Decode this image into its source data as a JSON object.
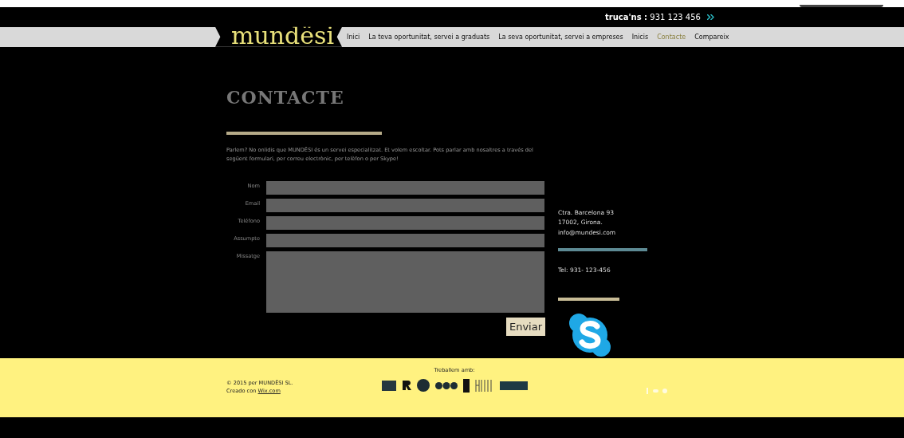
{
  "header": {
    "call_label": "truca'ns :",
    "phone": "931 123 456",
    "logo": "mundësi"
  },
  "nav": [
    {
      "label": "Inici",
      "selected": false
    },
    {
      "label": "La teva oportunitat, servei a graduats",
      "selected": false
    },
    {
      "label": "La seva oportunitat, servei a empreses",
      "selected": false
    },
    {
      "label": "Inicis",
      "selected": false
    },
    {
      "label": "Contacte",
      "selected": true
    },
    {
      "label": "Compareix",
      "selected": false
    }
  ],
  "page": {
    "title": "CONTACTE",
    "intro": "Parlem? No onlidis que MUNDËSI és un servei especialitzat. Et volem escoltar. Pots parlar amb nosaltres a través del següent formulari, per correu electrònic, per telèfon o per Skype!"
  },
  "form": {
    "fields": [
      {
        "label": "Nom",
        "kind": "line"
      },
      {
        "label": "Email",
        "kind": "line"
      },
      {
        "label": "Teléfono",
        "kind": "line"
      },
      {
        "label": "Assumpte",
        "kind": "line"
      },
      {
        "label": "Missatge",
        "kind": "area"
      }
    ],
    "submit": "Enviar"
  },
  "contact": {
    "address": [
      "Ctra. Barcelona 93",
      "17002, Girona.",
      "info@mundesi.com"
    ],
    "phone": "Tel: 931- 123-456"
  },
  "footer": {
    "copyright": "© 2015 per MUNDËSI SL.",
    "created_prefix": "Creado con",
    "created_link": "Wix.com",
    "partners_title": "Treballem amb:"
  }
}
